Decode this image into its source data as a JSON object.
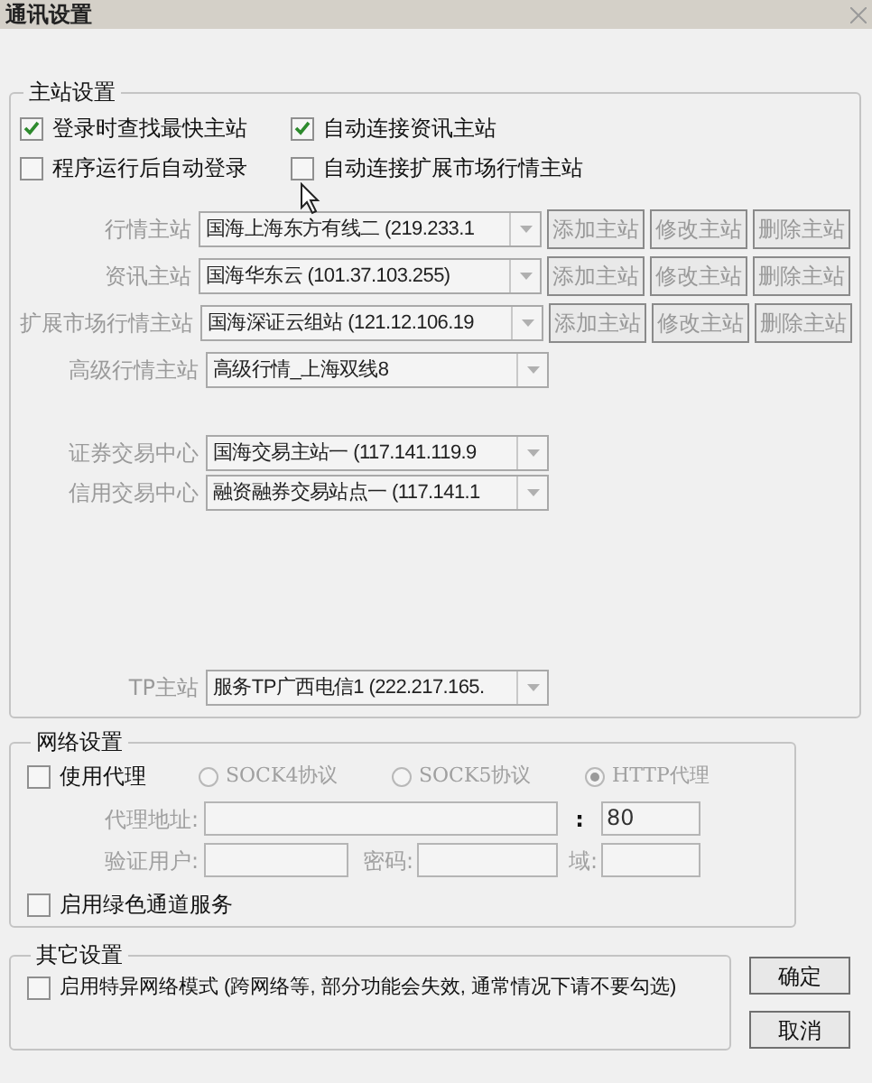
{
  "window": {
    "title": "通讯设置"
  },
  "main_station": {
    "legend": "主站设置",
    "options": [
      {
        "label": "登录时查找最快主站",
        "checked": true
      },
      {
        "label": "自动连接资讯主站",
        "checked": true
      },
      {
        "label": "程序运行后自动登录",
        "checked": false
      },
      {
        "label": "自动连接扩展市场行情主站",
        "checked": false
      }
    ],
    "stations": [
      {
        "label": "行情主站",
        "value": "国海上海东方有线二 (219.233.1",
        "buttons": [
          "添加主站",
          "修改主站",
          "删除主站"
        ]
      },
      {
        "label": "资讯主站",
        "value": "国海华东云 (101.37.103.255)",
        "buttons": [
          "添加主站",
          "修改主站",
          "删除主站"
        ]
      },
      {
        "label": "扩展市场行情主站",
        "value": "国海深证云组站 (121.12.106.19",
        "buttons": [
          "添加主站",
          "修改主站",
          "删除主站"
        ]
      },
      {
        "label": "高级行情主站",
        "value": "高级行情_上海双线8"
      }
    ],
    "trade_centers": [
      {
        "label": "证券交易中心",
        "value": "国海交易主站一 (117.141.119.9"
      },
      {
        "label": "信用交易中心",
        "value": "融资融券交易站点一 (117.141.1"
      }
    ],
    "tp_station": {
      "label": "TP主站",
      "value": "服务TP广西电信1 (222.217.165."
    }
  },
  "network": {
    "legend": "网络设置",
    "use_proxy": {
      "label": "使用代理",
      "checked": false
    },
    "protocols": [
      {
        "label": "SOCK4协议",
        "selected": false
      },
      {
        "label": "SOCK5协议",
        "selected": false
      },
      {
        "label": "HTTP代理",
        "selected": true
      }
    ],
    "address_label": "代理地址:",
    "port_separator": ":",
    "port": "80",
    "user_label": "验证用户:",
    "password_label": "密码:",
    "domain_label": "域:",
    "green_channel": {
      "label": "启用绿色通道服务",
      "checked": false
    }
  },
  "other": {
    "legend": "其它设置",
    "special_mode": {
      "label": "启用特异网络模式 (跨网络等, 部分功能会失效, 通常情况下请不要勾选)",
      "checked": false
    }
  },
  "buttons": [
    "确定",
    "取消"
  ]
}
